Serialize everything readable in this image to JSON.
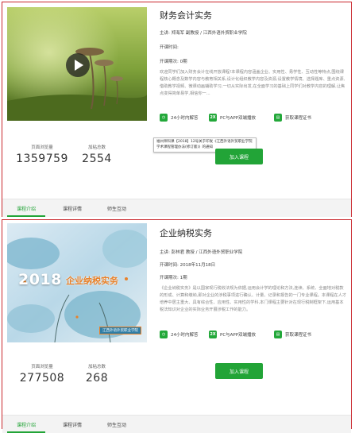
{
  "courses": [
    {
      "title": "财务会计实务",
      "lecturer_label": "主讲:",
      "lecturer": "郑海军 副教授 / 江西外语外贸职业学院",
      "start_label": "开课时间:",
      "start_value": "",
      "sessions_label": "开课期次:",
      "sessions_value": "0期",
      "description": "欢迎同学们加入财务会计在线开放课程!本课程内容涵盖企业、实用性、易学性、互动性等特点,围绕课程核心概念及数学内容与教育相关系,设计化组织教学内容及资源,设置教学情境、选择题库、重点资源,借助教学视频、微课动画辅助学习,一切从实际出发,在全面学习的基础上同学们对教学内容的理解,让焦点变得简单易学,相信你一...",
      "features": [
        "24小时内解答",
        "PC与APP双端播放",
        "获取课程证书"
      ],
      "views_label": "页面浏览量",
      "views": "1359759",
      "learners_label": "加粘总数",
      "learners": "2554",
      "join_label": "加入课程",
      "tooltip": "福州师科课【2018】12号关于印发《江西外语外贸职业学院学术课程管理办法(修订版)》的通知",
      "tabs": [
        "课程介绍",
        "课程详情",
        "师生互动"
      ]
    },
    {
      "title": "企业纳税实务",
      "lecturer_label": "主讲:",
      "lecturer": "彭林君 教授 / 江西外语外贸职业学院",
      "start_label": "开课时间:",
      "start_value": "2018年11月18日",
      "sessions_label": "开课期次:",
      "sessions_value": "1期",
      "description": "《企业纳税实务》是以国家现行税收法规为依据,运用会计学的理论和方法,连续、系统、全面地对税款的形成、计算和缴纳,即对企业的涉税事项进行确认、计量、记录和报告的一门专业课程。本课程在人才培养中居主重大、具有综合性、应用性、实用性的学科,本门课程主要针对在现行税制框架下,运用基本税法知识对企业的实际业务开展涉税工作的能力。",
      "features": [
        "24小时内解答",
        "PC与APP双端播放",
        "获取课程证书"
      ],
      "views_label": "页面浏览量",
      "views": "277508",
      "learners_label": "加粘总数",
      "learners": "268",
      "join_label": "加入课程",
      "banner_year": "2018",
      "banner_title": "企业纳税实务",
      "banner_school": "江西外语外贸职业学院",
      "tabs": [
        "课程介绍",
        "课程详情",
        "师生互动"
      ]
    }
  ],
  "colors": {
    "accent": "#22a437",
    "border": "#c9262c"
  },
  "icons": {
    "play": "play-icon",
    "feature_clock": "clock-icon",
    "feature_device": "2x-icon",
    "feature_cert": "certificate-icon"
  }
}
